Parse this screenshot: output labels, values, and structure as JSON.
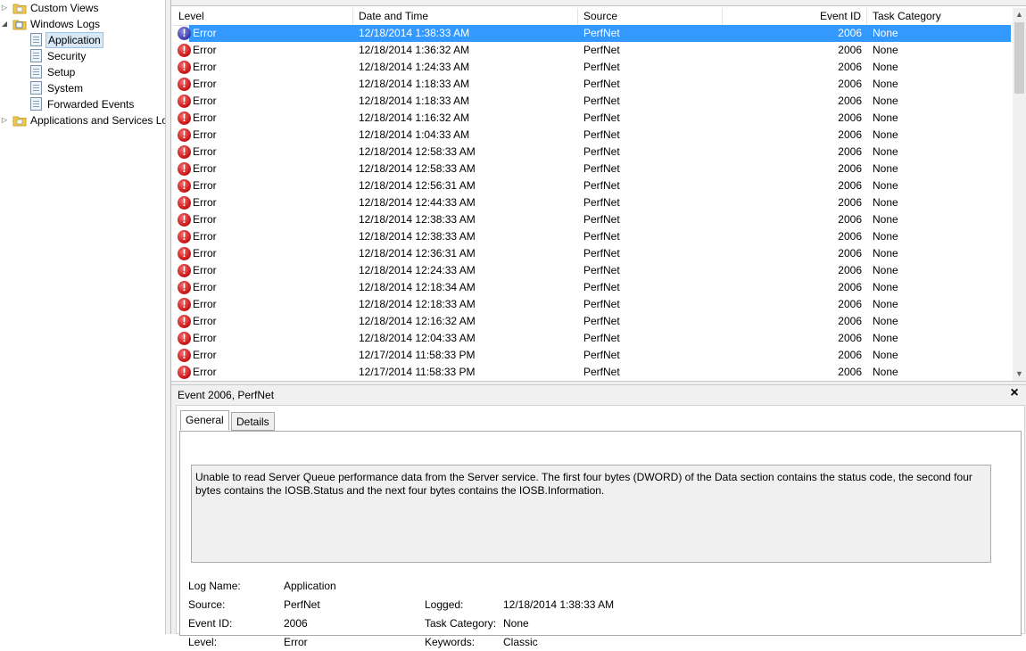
{
  "tree": {
    "items": [
      {
        "label": "Custom Views",
        "icon": "folder-icon",
        "expand": "collapsed"
      },
      {
        "label": "Windows Logs",
        "icon": "folder-icon",
        "expand": "expanded"
      },
      {
        "label": "Application",
        "icon": "log-icon",
        "selected": true
      },
      {
        "label": "Security",
        "icon": "log-icon"
      },
      {
        "label": "Setup",
        "icon": "log-icon"
      },
      {
        "label": "System",
        "icon": "log-icon"
      },
      {
        "label": "Forwarded Events",
        "icon": "log-icon"
      },
      {
        "label": "Applications and Services Lo",
        "icon": "folder-icon",
        "expand": "collapsed"
      }
    ]
  },
  "list": {
    "columns": {
      "level": "Level",
      "date": "Date and Time",
      "source": "Source",
      "event_id": "Event ID",
      "task": "Task Category"
    },
    "rows": [
      {
        "level": "Error",
        "date": "12/18/2014 1:38:33 AM",
        "source": "PerfNet",
        "id": "2006",
        "task": "None",
        "selected": true
      },
      {
        "level": "Error",
        "date": "12/18/2014 1:36:32 AM",
        "source": "PerfNet",
        "id": "2006",
        "task": "None"
      },
      {
        "level": "Error",
        "date": "12/18/2014 1:24:33 AM",
        "source": "PerfNet",
        "id": "2006",
        "task": "None"
      },
      {
        "level": "Error",
        "date": "12/18/2014 1:18:33 AM",
        "source": "PerfNet",
        "id": "2006",
        "task": "None"
      },
      {
        "level": "Error",
        "date": "12/18/2014 1:18:33 AM",
        "source": "PerfNet",
        "id": "2006",
        "task": "None"
      },
      {
        "level": "Error",
        "date": "12/18/2014 1:16:32 AM",
        "source": "PerfNet",
        "id": "2006",
        "task": "None"
      },
      {
        "level": "Error",
        "date": "12/18/2014 1:04:33 AM",
        "source": "PerfNet",
        "id": "2006",
        "task": "None"
      },
      {
        "level": "Error",
        "date": "12/18/2014 12:58:33 AM",
        "source": "PerfNet",
        "id": "2006",
        "task": "None"
      },
      {
        "level": "Error",
        "date": "12/18/2014 12:58:33 AM",
        "source": "PerfNet",
        "id": "2006",
        "task": "None"
      },
      {
        "level": "Error",
        "date": "12/18/2014 12:56:31 AM",
        "source": "PerfNet",
        "id": "2006",
        "task": "None"
      },
      {
        "level": "Error",
        "date": "12/18/2014 12:44:33 AM",
        "source": "PerfNet",
        "id": "2006",
        "task": "None"
      },
      {
        "level": "Error",
        "date": "12/18/2014 12:38:33 AM",
        "source": "PerfNet",
        "id": "2006",
        "task": "None"
      },
      {
        "level": "Error",
        "date": "12/18/2014 12:38:33 AM",
        "source": "PerfNet",
        "id": "2006",
        "task": "None"
      },
      {
        "level": "Error",
        "date": "12/18/2014 12:36:31 AM",
        "source": "PerfNet",
        "id": "2006",
        "task": "None"
      },
      {
        "level": "Error",
        "date": "12/18/2014 12:24:33 AM",
        "source": "PerfNet",
        "id": "2006",
        "task": "None"
      },
      {
        "level": "Error",
        "date": "12/18/2014 12:18:34 AM",
        "source": "PerfNet",
        "id": "2006",
        "task": "None"
      },
      {
        "level": "Error",
        "date": "12/18/2014 12:18:33 AM",
        "source": "PerfNet",
        "id": "2006",
        "task": "None"
      },
      {
        "level": "Error",
        "date": "12/18/2014 12:16:32 AM",
        "source": "PerfNet",
        "id": "2006",
        "task": "None"
      },
      {
        "level": "Error",
        "date": "12/18/2014 12:04:33 AM",
        "source": "PerfNet",
        "id": "2006",
        "task": "None"
      },
      {
        "level": "Error",
        "date": "12/17/2014 11:58:33 PM",
        "source": "PerfNet",
        "id": "2006",
        "task": "None"
      },
      {
        "level": "Error",
        "date": "12/17/2014 11:58:33 PM",
        "source": "PerfNet",
        "id": "2006",
        "task": "None"
      }
    ],
    "selection_color": "#3399ff",
    "error_icon": "error-icon"
  },
  "preview": {
    "title": "Event 2006, PerfNet",
    "close_glyph": "×",
    "tabs": [
      "General",
      "Details"
    ],
    "active_tab": "General",
    "description": "Unable to read Server Queue performance data from the Server service. The first four bytes (DWORD) of the Data section contains the status code, the second four bytes contains the IOSB.Status and the next four bytes contains the IOSB.Information.",
    "fields": {
      "log_name_label": "Log Name:",
      "log_name": "Application",
      "source_label": "Source:",
      "source": "PerfNet",
      "logged_label": "Logged:",
      "logged": "12/18/2014 1:38:33 AM",
      "event_id_label": "Event ID:",
      "event_id": "2006",
      "task_label": "Task Category:",
      "task": "None",
      "level_label": "Level:",
      "level": "Error",
      "keywords_label": "Keywords:",
      "keywords": "Classic"
    }
  }
}
